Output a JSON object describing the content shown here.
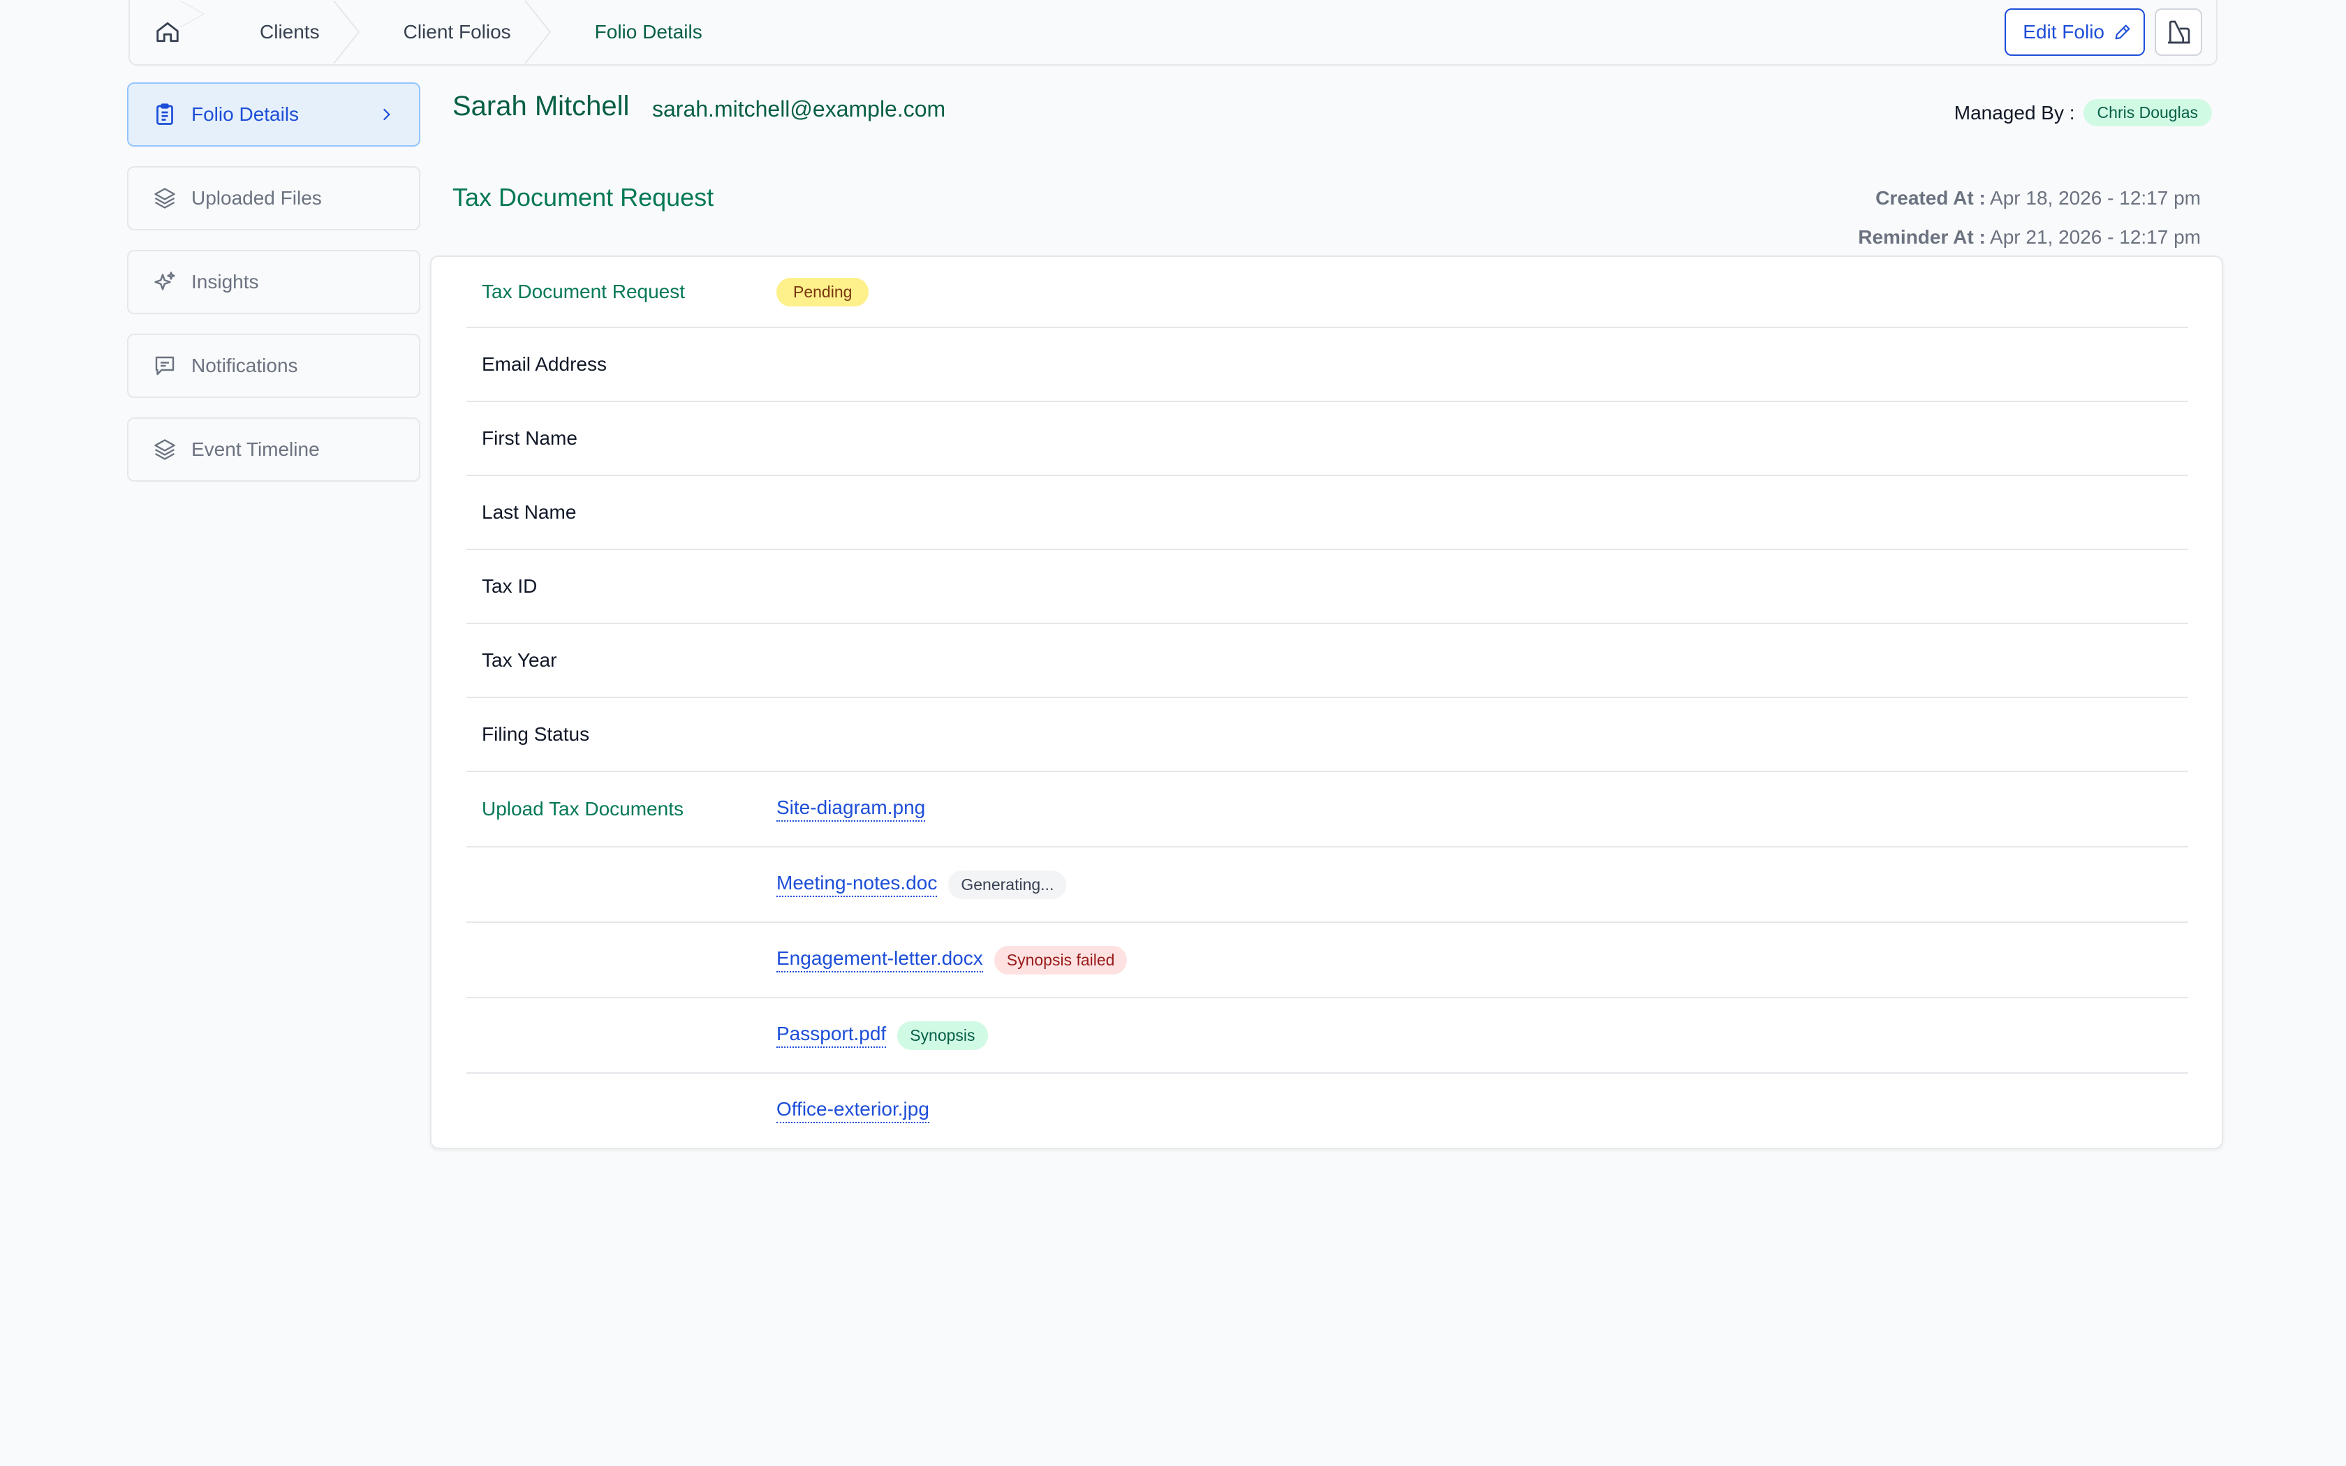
{
  "breadcrumb": {
    "items": [
      "Clients",
      "Client Folios",
      "Folio Details"
    ],
    "edit_label": "Edit Folio"
  },
  "sidebar": {
    "items": [
      {
        "label": "Folio Details",
        "icon": "clipboard-icon",
        "active": true
      },
      {
        "label": "Uploaded Files",
        "icon": "layers-icon"
      },
      {
        "label": "Insights",
        "icon": "sparkles-icon"
      },
      {
        "label": "Notifications",
        "icon": "message-icon"
      },
      {
        "label": "Event Timeline",
        "icon": "layers-icon"
      }
    ]
  },
  "header": {
    "name": "Sarah Mitchell",
    "email": "sarah.mitchell@example.com",
    "managed_by_label": "Managed By :",
    "managed_by": "Chris Douglas"
  },
  "section": {
    "title": "Tax Document Request",
    "created_label": "Created At :",
    "created_value": "Apr 18, 2026 - 12:17 pm",
    "reminder_label": "Reminder At :",
    "reminder_value": "Apr 21, 2026 - 12:17 pm"
  },
  "details": {
    "request_label": "Tax Document Request",
    "status": "Pending",
    "fields": [
      "Email Address",
      "First Name",
      "Last Name",
      "Tax ID",
      "Tax Year",
      "Filing Status"
    ],
    "upload_label": "Upload Tax Documents",
    "files": [
      {
        "name": "Site-diagram.png",
        "badge": ""
      },
      {
        "name": "Meeting-notes.doc",
        "badge": "Generating..."
      },
      {
        "name": "Engagement-letter.docx",
        "badge": "Synopsis failed"
      },
      {
        "name": "Passport.pdf",
        "badge": "Synopsis"
      },
      {
        "name": "Office-exterior.jpg",
        "badge": ""
      }
    ]
  },
  "colors": {
    "accent_green": "#065f46",
    "link_blue": "#1d4ed8",
    "active_bg": "#e6f0fb"
  }
}
